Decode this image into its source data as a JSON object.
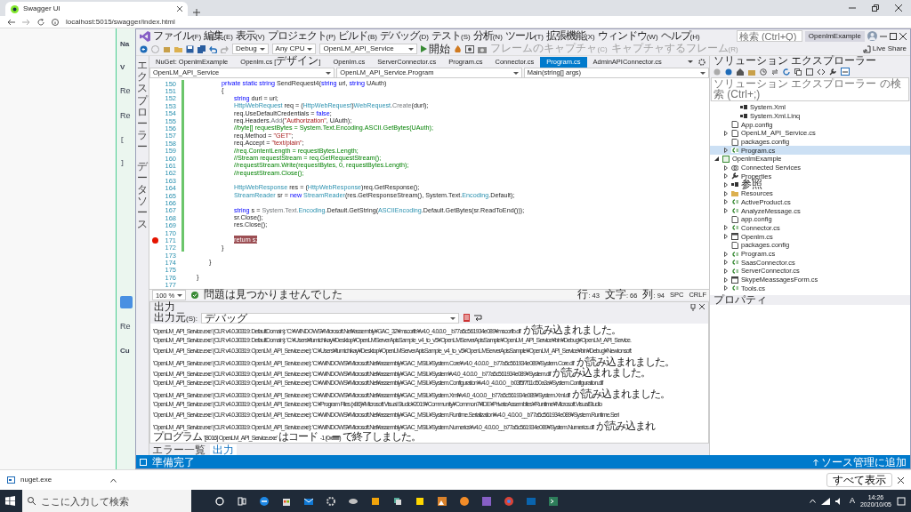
{
  "browser": {
    "tab_title": "Swagger UI",
    "address": "localhost:5015/swagger/index.html",
    "fragments": [
      {
        "kind": "label",
        "text": "Na"
      },
      {
        "kind": "bold",
        "text": "V"
      },
      {
        "kind": "heading",
        "text": "Re"
      },
      {
        "kind": "heading",
        "text": "Re"
      },
      {
        "kind": "code",
        "text": "["
      },
      {
        "kind": "code",
        "text": "]"
      },
      {
        "kind": "button"
      },
      {
        "kind": "heading",
        "text": "Re"
      },
      {
        "kind": "label",
        "text": "Cu"
      }
    ]
  },
  "vs": {
    "menus": [
      "ファイル(F)",
      "編集(E)",
      "表示(V)",
      "プロジェクト(P)",
      "ビルド(B)",
      "デバッグ(D)",
      "テスト(S)",
      "分析(N)",
      "ツール(T)",
      "拡張機能(X)",
      "ウィンドウ(W)",
      "ヘルプ(H)"
    ],
    "search": {
      "placeholder": "検索 (Ctrl+Q)"
    },
    "solution_name": "OpenlmExample",
    "toolbar": {
      "configuration": "Debug",
      "platform": "Any CPU",
      "startup_project": "OpenLM_API_Service",
      "start": "開始",
      "capture_frame": "フレームのキャプチャ(C)",
      "frames_to_capture": "キャプチャするフレーム(R)",
      "live_share": "Live Share"
    },
    "side_tabs": [
      "エクスプローラー",
      "データソース"
    ],
    "doc_tabs": [
      {
        "label": "NuGet: OpenlmExample",
        "selected": false
      },
      {
        "label": "Openlm.cs [デザイン]",
        "selected": false
      },
      {
        "label": "Openlm.cs",
        "selected": false
      },
      {
        "label": "ServerConnector.cs",
        "selected": false
      },
      {
        "label": "Program.cs",
        "selected": false
      },
      {
        "label": "Connector.cs",
        "selected": false
      },
      {
        "label": "Program.cs",
        "selected": true
      },
      {
        "label": "AdminAPIConnector.cs",
        "selected": false
      }
    ],
    "nav": {
      "project": "OpenLM_API_Service",
      "type": "OpenLM_API_Service.Program",
      "member": "Main(string[] args)"
    },
    "code_lines": [
      {
        "number": "150",
        "changed": true,
        "breakpoint": false,
        "tokens": [
          {
            "kind": "keyword",
            "text": "private static string"
          },
          {
            "kind": "plain",
            "text": " SendRequest4("
          },
          {
            "kind": "keyword",
            "text": "string"
          },
          {
            "kind": "plain",
            "text": " url, "
          },
          {
            "kind": "keyword",
            "text": "string"
          },
          {
            "kind": "plain",
            "text": " UAuth)"
          }
        ]
      },
      {
        "number": "151",
        "changed": true,
        "breakpoint": false,
        "tokens": [
          {
            "kind": "plain",
            "text": "{"
          }
        ]
      },
      {
        "number": "152",
        "changed": true,
        "breakpoint": false,
        "tokens": [
          {
            "kind": "keyword",
            "text": "string"
          },
          {
            "kind": "plain",
            "text": " durl = url;"
          }
        ]
      },
      {
        "number": "153",
        "changed": true,
        "breakpoint": false,
        "tokens": [
          {
            "kind": "type",
            "text": "HttpWebRequest"
          },
          {
            "kind": "plain",
            "text": " req = ("
          },
          {
            "kind": "type",
            "text": "HttpWebRequest"
          },
          {
            "kind": "plain",
            "text": ")"
          },
          {
            "kind": "type",
            "text": "WebRequest"
          },
          {
            "kind": "plain",
            "text": "."
          },
          {
            "kind": "method",
            "text": "Create"
          },
          {
            "kind": "plain",
            "text": "(durl);"
          }
        ]
      },
      {
        "number": "154",
        "changed": true,
        "breakpoint": false,
        "tokens": [
          {
            "kind": "plain",
            "text": "req.UseDefaultCredentials = "
          },
          {
            "kind": "keyword",
            "text": "false"
          },
          {
            "kind": "plain",
            "text": ";"
          }
        ]
      },
      {
        "number": "155",
        "changed": true,
        "breakpoint": false,
        "tokens": [
          {
            "kind": "plain",
            "text": "req.Headers."
          },
          {
            "kind": "method",
            "text": "Add"
          },
          {
            "kind": "plain",
            "text": "("
          },
          {
            "kind": "string",
            "text": "\"Authorization\""
          },
          {
            "kind": "plain",
            "text": ", UAuth);"
          }
        ]
      },
      {
        "number": "156",
        "changed": true,
        "breakpoint": false,
        "tokens": [
          {
            "kind": "comment",
            "text": "//byte[] requestBytes = System.Text.Encoding.ASCII.GetBytes(UAuth);"
          }
        ]
      },
      {
        "number": "157",
        "changed": true,
        "breakpoint": false,
        "tokens": [
          {
            "kind": "plain",
            "text": "req.Method = "
          },
          {
            "kind": "string",
            "text": "\"GET\""
          },
          {
            "kind": "plain",
            "text": ";"
          }
        ]
      },
      {
        "number": "158",
        "changed": true,
        "breakpoint": false,
        "tokens": [
          {
            "kind": "plain",
            "text": "req.Accept = "
          },
          {
            "kind": "string",
            "text": "\"text/plain\""
          },
          {
            "kind": "plain",
            "text": ";"
          }
        ]
      },
      {
        "number": "159",
        "changed": true,
        "breakpoint": false,
        "tokens": [
          {
            "kind": "comment",
            "text": "//req.ContentLength = requestBytes.Length;"
          }
        ]
      },
      {
        "number": "160",
        "changed": true,
        "breakpoint": false,
        "tokens": [
          {
            "kind": "comment",
            "text": "//Stream requestStream = req.GetRequestStream();"
          }
        ]
      },
      {
        "number": "161",
        "changed": true,
        "breakpoint": false,
        "tokens": [
          {
            "kind": "comment",
            "text": "//requestStream.Write(requestBytes, 0, requestBytes.Length);"
          }
        ]
      },
      {
        "number": "162",
        "changed": true,
        "breakpoint": false,
        "tokens": [
          {
            "kind": "comment",
            "text": "//requestStream.Close();"
          }
        ]
      },
      {
        "number": "163",
        "changed": true,
        "breakpoint": false
      },
      {
        "number": "164",
        "changed": true,
        "breakpoint": false,
        "tokens": [
          {
            "kind": "type",
            "text": "HttpWebResponse"
          },
          {
            "kind": "plain",
            "text": " res = ("
          },
          {
            "kind": "type",
            "text": "HttpWebResponse"
          },
          {
            "kind": "plain",
            "text": ")req.GetResponse();"
          }
        ]
      },
      {
        "number": "165",
        "changed": true,
        "breakpoint": false,
        "tokens": [
          {
            "kind": "type",
            "text": "StreamReader"
          },
          {
            "kind": "plain",
            "text": " sr = "
          },
          {
            "kind": "keyword",
            "text": "new"
          },
          {
            "kind": "type",
            "text": " StreamReader"
          },
          {
            "kind": "plain",
            "text": "(res.GetResponseStream(), System.Text."
          },
          {
            "kind": "type",
            "text": "Encoding"
          },
          {
            "kind": "plain",
            "text": ".Default);"
          }
        ]
      },
      {
        "number": "166",
        "changed": true,
        "breakpoint": false
      },
      {
        "number": "167",
        "changed": true,
        "breakpoint": false,
        "tokens": [
          {
            "kind": "keyword",
            "text": "string"
          },
          {
            "kind": "plain",
            "text": " s = "
          },
          {
            "kind": "method",
            "text": "System.Text."
          },
          {
            "kind": "type",
            "text": "Encoding"
          },
          {
            "kind": "plain",
            "text": ".Default.GetString("
          },
          {
            "kind": "type",
            "text": "ASCIIEncoding"
          },
          {
            "kind": "plain",
            "text": ".Default.GetBytes(sr.ReadToEnd()));"
          }
        ]
      },
      {
        "number": "168",
        "changed": true,
        "breakpoint": false,
        "tokens": [
          {
            "kind": "plain",
            "text": "sr.Close();"
          }
        ]
      },
      {
        "number": "169",
        "changed": true,
        "breakpoint": false,
        "tokens": [
          {
            "kind": "plain",
            "text": "res.Close();"
          }
        ]
      },
      {
        "number": "170",
        "changed": true,
        "breakpoint": false
      },
      {
        "number": "171",
        "changed": true,
        "breakpoint": true,
        "tokens": [
          {
            "kind": "break",
            "text": "return s;"
          }
        ]
      },
      {
        "number": "172",
        "changed": true,
        "breakpoint": false,
        "tokens": [
          {
            "kind": "plain",
            "text": "}"
          }
        ]
      },
      {
        "number": "173",
        "changed": false,
        "breakpoint": false
      },
      {
        "number": "174",
        "changed": false,
        "breakpoint": false,
        "tokens": [
          {
            "kind": "plain",
            "text": "}"
          }
        ]
      },
      {
        "number": "175",
        "changed": false,
        "breakpoint": false
      },
      {
        "number": "176",
        "changed": false,
        "breakpoint": false,
        "tokens": [
          {
            "kind": "plain",
            "text": "}"
          }
        ]
      },
      {
        "number": "177",
        "changed": false,
        "breakpoint": false
      }
    ],
    "editor_status": {
      "zoom": "100 %",
      "issues": "問題は見つかりませんでした",
      "line": "行: 43",
      "char": "文字: 66",
      "column": "列: 94",
      "spacing": "SPC",
      "eol": "CRLF"
    },
    "output": {
      "title": "出力",
      "source_label": "出力元(S):",
      "source": "デバッグ",
      "lines": [
        "'OpenLM_API_Service.exe' (CLR v4.0.30319: DefaultDomain): 'C:¥WINDOWS¥Microsoft.Net¥assembly¥GAC_32¥mscorlib¥v4.0_4.0.0.0__b77a5c561934e089¥mscorlib.dll' が読み込まれました。",
        "'OpenLM_API_Service.exe' (CLR v4.0.30319: DefaultDomain): 'C:¥Users¥fumichikay¥Desktop¥OpenLMServerApisSample_v4_to_v5¥OpenLMServerApisSample¥OpenLM_API_Service¥bin¥Debug¥OpenLM_API_Service.",
        "'OpenLM_API_Service.exe' (CLR v4.0.30319: OpenLM_API_Service.exe): 'C:¥Users¥fumichikay¥Desktop¥OpenLMServerApisSample_v4_to_v5¥OpenLMServerApisSample¥OpenLM_API_Service¥bin¥Debug¥Newtonsoft",
        "'OpenLM_API_Service.exe' (CLR v4.0.30319: OpenLM_API_Service.exe): 'C:¥WINDOWS¥Microsoft.Net¥assembly¥GAC_MSIL¥System.Core¥v4.0_4.0.0.0__b77a5c561934e089¥System.Core.dll' が読み込まれました。",
        "'OpenLM_API_Service.exe' (CLR v4.0.30319: OpenLM_API_Service.exe): 'C:¥WINDOWS¥Microsoft.Net¥assembly¥GAC_MSIL¥System¥v4.0_4.0.0.0__b77a5c561934e089¥System.dll' が読み込まれました。",
        "'OpenLM_API_Service.exe' (CLR v4.0.30319: OpenLM_API_Service.exe): 'C:¥WINDOWS¥Microsoft.Net¥assembly¥GAC_MSIL¥System.Configuration¥v4.0_4.0.0.0__b03f5f7f11d50a3a¥System.Configuration.dll'",
        "'OpenLM_API_Service.exe' (CLR v4.0.30319: OpenLM_API_Service.exe): 'C:¥WINDOWS¥Microsoft.Net¥assembly¥GAC_MSIL¥System.Xml¥v4.0_4.0.0.0__b77a5c561934e089¥System.Xml.dll' が読み込まれました。",
        "'OpenLM_API_Service.exe' (CLR v4.0.30319: OpenLM_API_Service.exe): 'C:¥Program Files (x86)¥Microsoft Visual Studio¥2019¥Community¥Common7¥IDE¥PrivateAssemblies¥Runtime¥Microsoft.VisualStudio",
        "'OpenLM_API_Service.exe' (CLR v4.0.30319: OpenLM_API_Service.exe): 'C:¥WINDOWS¥Microsoft.Net¥assembly¥GAC_MSIL¥System.Runtime.Serialization¥v4.0_4.0.0.0__b77a5c561934e089¥System.Runtime.Seri",
        "'OpenLM_API_Service.exe' (CLR v4.0.30319: OpenLM_API_Service.exe): 'C:¥WINDOWS¥Microsoft.Net¥assembly¥GAC_MSIL¥System.Numerics¥v4.0_4.0.0.0__b77a5c561934e089¥System.Numerics.dll' が読み込まれ",
        "プログラム '[8016] OpenLM_API_Service.exe' はコード -1 (0xffffffff) で終了しました。"
      ]
    },
    "bottom_tabs": [
      {
        "label": "エラー一覧",
        "selected": false
      },
      {
        "label": "出力",
        "selected": true
      }
    ],
    "solution_explorer": {
      "title": "ソリューション エクスプローラー",
      "search": {
        "placeholder": "ソリューション エクスプローラー の検索 (Ctrl+;)"
      },
      "tree": [
        {
          "children": [
            {
              "children": [
                {
                  "label": "System.Xml",
                  "kind": "reference",
                  "selected": false
                },
                {
                  "label": "System.Xml.Linq",
                  "kind": "reference",
                  "selected": false
                }
              ]
            },
            {
              "label": "App.config",
              "kind": "config",
              "selected": false
            },
            {
              "label": "OpenLM_API_Service.cs",
              "kind": "file",
              "expanded": false,
              "selected": false
            },
            {
              "label": "packages.config",
              "kind": "config",
              "selected": false
            },
            {
              "label": "Program.cs",
              "kind": "csharp",
              "expanded": false,
              "selected": true
            }
          ]
        },
        {
          "label": "OpenlmExample",
          "kind": "project",
          "expanded": true,
          "selected": false,
          "children": [
            {
              "label": "Connected Services",
              "kind": "connected",
              "expanded": false,
              "selected": false
            },
            {
              "label": "Properties",
              "kind": "wrench",
              "expanded": false,
              "selected": false
            },
            {
              "label": "参照",
              "kind": "reference",
              "expanded": false,
              "selected": false
            },
            {
              "label": "Resources",
              "kind": "folder",
              "expanded": false,
              "selected": false
            },
            {
              "label": "ActiveProduct.cs",
              "kind": "csharp",
              "expanded": false,
              "selected": false
            },
            {
              "label": "AnalyzeMessage.cs",
              "kind": "csharp",
              "expanded": false,
              "selected": false
            },
            {
              "label": "app.config",
              "kind": "config",
              "selected": false
            },
            {
              "label": "Connector.cs",
              "kind": "csharp",
              "expanded": false,
              "selected": false
            },
            {
              "label": "Openlm.cs",
              "kind": "form",
              "expanded": false,
              "selected": false
            },
            {
              "label": "packages.config",
              "kind": "config",
              "selected": false
            },
            {
              "label": "Program.cs",
              "kind": "csharp",
              "expanded": false,
              "selected": false
            },
            {
              "label": "SaasConnector.cs",
              "kind": "csharp",
              "expanded": false,
              "selected": false
            },
            {
              "label": "ServerConnector.cs",
              "kind": "csharp",
              "expanded": false,
              "selected": false
            },
            {
              "label": "SkypeMeassagesForm.cs",
              "kind": "form",
              "expanded": false,
              "selected": false
            },
            {
              "label": "Tools.cs",
              "kind": "csharp",
              "expanded": false,
              "selected": false
            }
          ]
        }
      ]
    },
    "properties": {
      "title": "プロパティ"
    },
    "status": {
      "message": "準備完了",
      "source_control": "ソース管理に追加"
    }
  },
  "downloads": {
    "file": "nuget.exe",
    "show_all": "すべて表示"
  },
  "taskbar": {
    "search": {
      "placeholder": "ここに入力して検索"
    },
    "time": "14:26",
    "date": "2020/10/05",
    "ime": "A"
  }
}
